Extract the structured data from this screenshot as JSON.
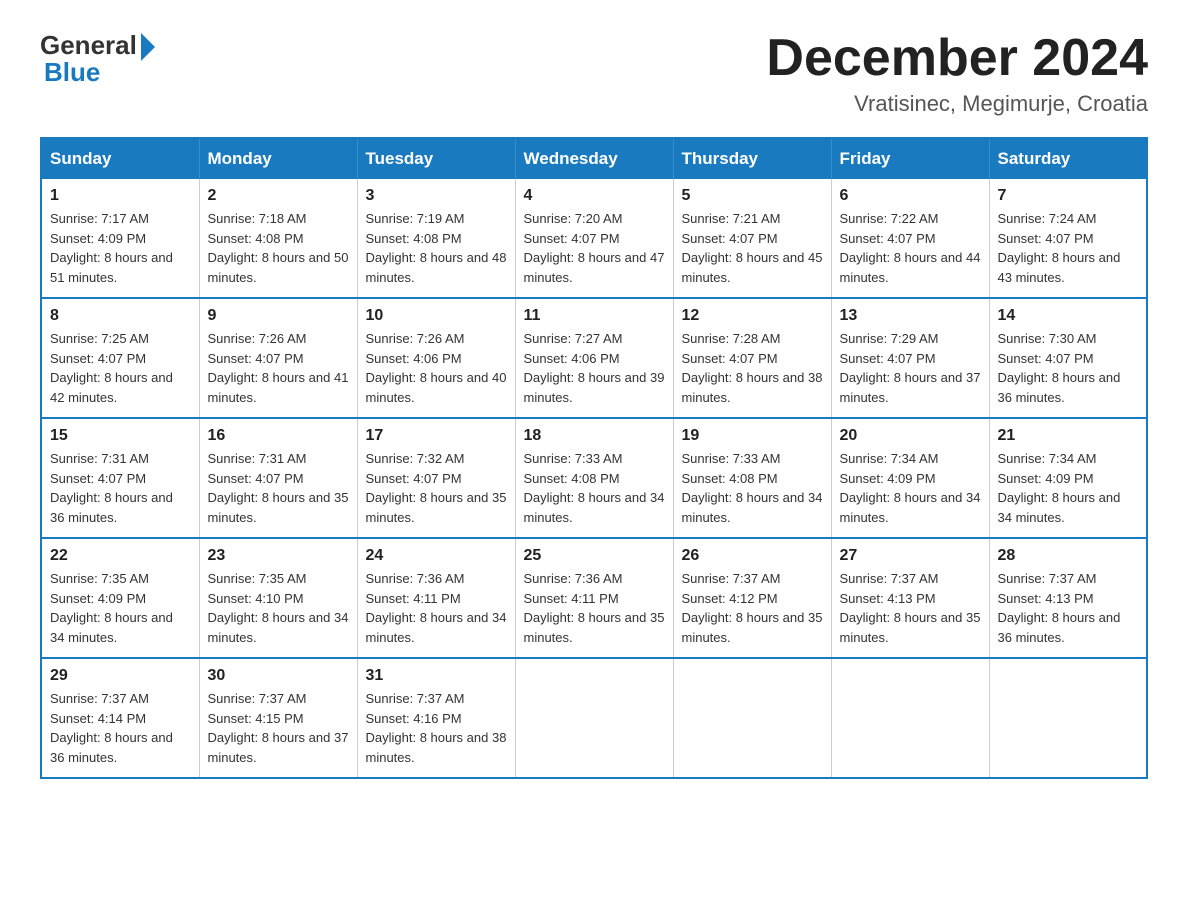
{
  "header": {
    "logo_general": "General",
    "logo_blue": "Blue",
    "month_title": "December 2024",
    "location": "Vratisinec, Megimurje, Croatia"
  },
  "calendar": {
    "days_of_week": [
      "Sunday",
      "Monday",
      "Tuesday",
      "Wednesday",
      "Thursday",
      "Friday",
      "Saturday"
    ],
    "weeks": [
      [
        {
          "day": "1",
          "sunrise": "Sunrise: 7:17 AM",
          "sunset": "Sunset: 4:09 PM",
          "daylight": "Daylight: 8 hours and 51 minutes."
        },
        {
          "day": "2",
          "sunrise": "Sunrise: 7:18 AM",
          "sunset": "Sunset: 4:08 PM",
          "daylight": "Daylight: 8 hours and 50 minutes."
        },
        {
          "day": "3",
          "sunrise": "Sunrise: 7:19 AM",
          "sunset": "Sunset: 4:08 PM",
          "daylight": "Daylight: 8 hours and 48 minutes."
        },
        {
          "day": "4",
          "sunrise": "Sunrise: 7:20 AM",
          "sunset": "Sunset: 4:07 PM",
          "daylight": "Daylight: 8 hours and 47 minutes."
        },
        {
          "day": "5",
          "sunrise": "Sunrise: 7:21 AM",
          "sunset": "Sunset: 4:07 PM",
          "daylight": "Daylight: 8 hours and 45 minutes."
        },
        {
          "day": "6",
          "sunrise": "Sunrise: 7:22 AM",
          "sunset": "Sunset: 4:07 PM",
          "daylight": "Daylight: 8 hours and 44 minutes."
        },
        {
          "day": "7",
          "sunrise": "Sunrise: 7:24 AM",
          "sunset": "Sunset: 4:07 PM",
          "daylight": "Daylight: 8 hours and 43 minutes."
        }
      ],
      [
        {
          "day": "8",
          "sunrise": "Sunrise: 7:25 AM",
          "sunset": "Sunset: 4:07 PM",
          "daylight": "Daylight: 8 hours and 42 minutes."
        },
        {
          "day": "9",
          "sunrise": "Sunrise: 7:26 AM",
          "sunset": "Sunset: 4:07 PM",
          "daylight": "Daylight: 8 hours and 41 minutes."
        },
        {
          "day": "10",
          "sunrise": "Sunrise: 7:26 AM",
          "sunset": "Sunset: 4:06 PM",
          "daylight": "Daylight: 8 hours and 40 minutes."
        },
        {
          "day": "11",
          "sunrise": "Sunrise: 7:27 AM",
          "sunset": "Sunset: 4:06 PM",
          "daylight": "Daylight: 8 hours and 39 minutes."
        },
        {
          "day": "12",
          "sunrise": "Sunrise: 7:28 AM",
          "sunset": "Sunset: 4:07 PM",
          "daylight": "Daylight: 8 hours and 38 minutes."
        },
        {
          "day": "13",
          "sunrise": "Sunrise: 7:29 AM",
          "sunset": "Sunset: 4:07 PM",
          "daylight": "Daylight: 8 hours and 37 minutes."
        },
        {
          "day": "14",
          "sunrise": "Sunrise: 7:30 AM",
          "sunset": "Sunset: 4:07 PM",
          "daylight": "Daylight: 8 hours and 36 minutes."
        }
      ],
      [
        {
          "day": "15",
          "sunrise": "Sunrise: 7:31 AM",
          "sunset": "Sunset: 4:07 PM",
          "daylight": "Daylight: 8 hours and 36 minutes."
        },
        {
          "day": "16",
          "sunrise": "Sunrise: 7:31 AM",
          "sunset": "Sunset: 4:07 PM",
          "daylight": "Daylight: 8 hours and 35 minutes."
        },
        {
          "day": "17",
          "sunrise": "Sunrise: 7:32 AM",
          "sunset": "Sunset: 4:07 PM",
          "daylight": "Daylight: 8 hours and 35 minutes."
        },
        {
          "day": "18",
          "sunrise": "Sunrise: 7:33 AM",
          "sunset": "Sunset: 4:08 PM",
          "daylight": "Daylight: 8 hours and 34 minutes."
        },
        {
          "day": "19",
          "sunrise": "Sunrise: 7:33 AM",
          "sunset": "Sunset: 4:08 PM",
          "daylight": "Daylight: 8 hours and 34 minutes."
        },
        {
          "day": "20",
          "sunrise": "Sunrise: 7:34 AM",
          "sunset": "Sunset: 4:09 PM",
          "daylight": "Daylight: 8 hours and 34 minutes."
        },
        {
          "day": "21",
          "sunrise": "Sunrise: 7:34 AM",
          "sunset": "Sunset: 4:09 PM",
          "daylight": "Daylight: 8 hours and 34 minutes."
        }
      ],
      [
        {
          "day": "22",
          "sunrise": "Sunrise: 7:35 AM",
          "sunset": "Sunset: 4:09 PM",
          "daylight": "Daylight: 8 hours and 34 minutes."
        },
        {
          "day": "23",
          "sunrise": "Sunrise: 7:35 AM",
          "sunset": "Sunset: 4:10 PM",
          "daylight": "Daylight: 8 hours and 34 minutes."
        },
        {
          "day": "24",
          "sunrise": "Sunrise: 7:36 AM",
          "sunset": "Sunset: 4:11 PM",
          "daylight": "Daylight: 8 hours and 34 minutes."
        },
        {
          "day": "25",
          "sunrise": "Sunrise: 7:36 AM",
          "sunset": "Sunset: 4:11 PM",
          "daylight": "Daylight: 8 hours and 35 minutes."
        },
        {
          "day": "26",
          "sunrise": "Sunrise: 7:37 AM",
          "sunset": "Sunset: 4:12 PM",
          "daylight": "Daylight: 8 hours and 35 minutes."
        },
        {
          "day": "27",
          "sunrise": "Sunrise: 7:37 AM",
          "sunset": "Sunset: 4:13 PM",
          "daylight": "Daylight: 8 hours and 35 minutes."
        },
        {
          "day": "28",
          "sunrise": "Sunrise: 7:37 AM",
          "sunset": "Sunset: 4:13 PM",
          "daylight": "Daylight: 8 hours and 36 minutes."
        }
      ],
      [
        {
          "day": "29",
          "sunrise": "Sunrise: 7:37 AM",
          "sunset": "Sunset: 4:14 PM",
          "daylight": "Daylight: 8 hours and 36 minutes."
        },
        {
          "day": "30",
          "sunrise": "Sunrise: 7:37 AM",
          "sunset": "Sunset: 4:15 PM",
          "daylight": "Daylight: 8 hours and 37 minutes."
        },
        {
          "day": "31",
          "sunrise": "Sunrise: 7:37 AM",
          "sunset": "Sunset: 4:16 PM",
          "daylight": "Daylight: 8 hours and 38 minutes."
        },
        null,
        null,
        null,
        null
      ]
    ]
  }
}
